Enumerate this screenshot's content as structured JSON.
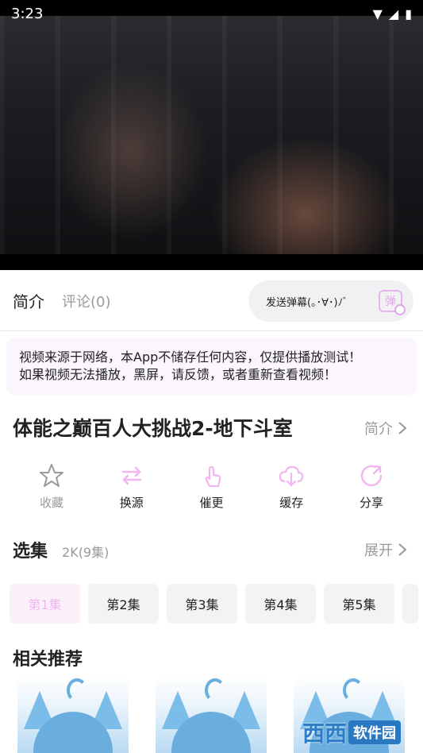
{
  "status": {
    "time": "3:23",
    "wifi_icon": "wifi-icon",
    "signal_icon": "signal-icon",
    "battery_icon": "battery-icon"
  },
  "tabs": [
    {
      "label": "简介"
    },
    {
      "label": "评论(0)"
    }
  ],
  "danmaku": {
    "placeholder": "发送弹幕(｡･∀･)ﾉﾞ",
    "icon_char": "弹"
  },
  "notice": {
    "line1": "视频来源于网络，本App不储存任何内容，仅提供播放测试！",
    "line2": "如果视频无法播放，黑屏，请反馈，或者重新查看视频！"
  },
  "video": {
    "title": "体能之巅百人大挑战2-地下斗室",
    "intro_link": "简介"
  },
  "actions": [
    {
      "label": "收藏",
      "icon": "star-icon"
    },
    {
      "label": "换源",
      "icon": "switch-source-icon"
    },
    {
      "label": "催更",
      "icon": "hand-tap-icon"
    },
    {
      "label": "缓存",
      "icon": "cloud-download-icon"
    },
    {
      "label": "分享",
      "icon": "share-icon"
    }
  ],
  "episodes": {
    "title": "选集",
    "subtitle": "2K(9集)",
    "expand": "展开",
    "items": [
      "第1集",
      "第2集",
      "第3集",
      "第4集",
      "第5集"
    ]
  },
  "related": {
    "title": "相关推荐"
  },
  "watermark": {
    "text1": "西西",
    "text2": "软件园"
  },
  "colors": {
    "accent": "#f1b6ef",
    "muted": "#9a9a9a"
  }
}
